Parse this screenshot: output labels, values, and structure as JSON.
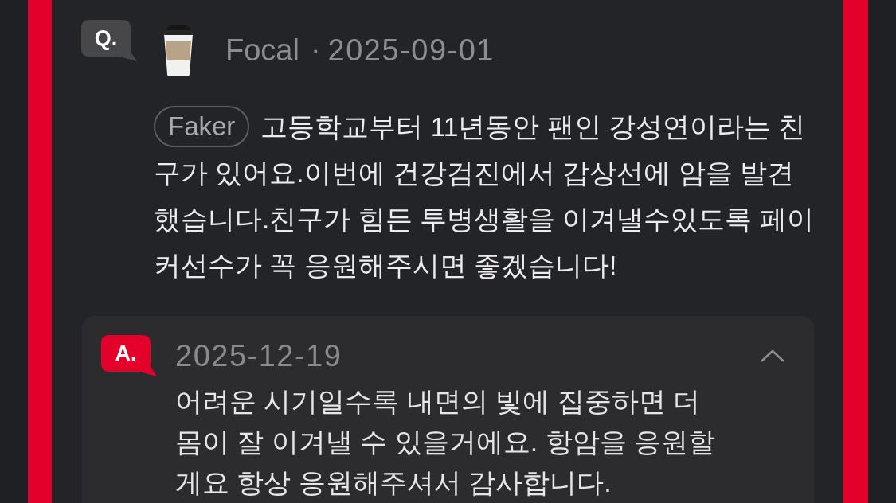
{
  "question": {
    "badge": "Q.",
    "author": "Focal",
    "separator": "·",
    "date": "2025-09-01",
    "tag": "Faker",
    "text": "고등학교부터 11년동안 팬인 강성연이라는 친구가 있어요.이번에 건강검진에서 갑상선에 암을 발견했습니다.친구가 힘든 투병생활을 이겨낼수있도록 페이커선수가 꼭 응원해주시면 좋겠습니다!"
  },
  "answer": {
    "badge": "A.",
    "date": "2025-12-19",
    "expanded": true,
    "text": "어려운 시기일수록 내면의 빛에 집중하면 더 몸이 잘 이겨낼 수 있을거에요. 항암을 응원할게요 항상 응원해주셔서 감사합니다."
  }
}
